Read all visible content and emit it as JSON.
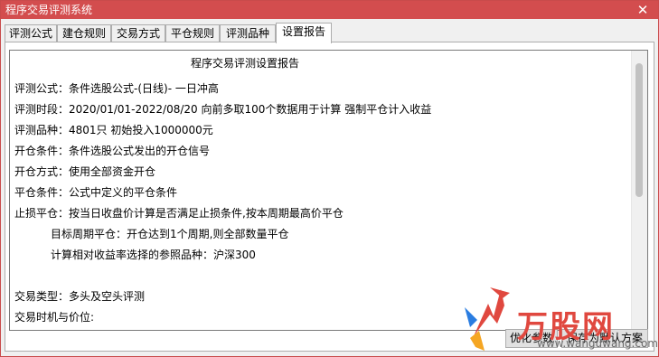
{
  "window": {
    "title": "程序交易评测系统",
    "close_glyph": "✕"
  },
  "tabs": [
    {
      "label": "评测公式",
      "active": false
    },
    {
      "label": "建仓规则",
      "active": false
    },
    {
      "label": "交易方式",
      "active": false
    },
    {
      "label": "平仓规则",
      "active": false
    },
    {
      "label": "评测品种",
      "active": false
    },
    {
      "label": "设置报告",
      "active": true
    }
  ],
  "report": {
    "title": "程序交易评测设置报告",
    "lines": [
      "评测公式：条件选股公式-(日线)- 一日冲高",
      "评测时段：2020/01/01-2022/08/20 向前多取100个数据用于计算 强制平仓计入收益",
      "评测品种：4801只 初始投入1000000元",
      "开仓条件：条件选股公式发出的开仓信号",
      "开仓方式：使用全部资金开仓",
      "平仓条件：公式中定义的平仓条件",
      "止损平仓：按当日收盘价计算是否满足止损条件,按本周期最高价平仓",
      "目标周期平仓：开仓达到1个周期,则全部数量平仓",
      "计算相对收益率选择的参照品种：沪深300",
      "",
      "交易类型：多头及空头评测",
      "交易时机与价位:"
    ]
  },
  "buttons": {
    "optimize": "优化参数",
    "save_default": "保存为默认方案"
  },
  "watermark": {
    "brand": "万股网",
    "url": "www.wanguwang.com"
  },
  "icons": {
    "close": "close-icon",
    "watermark_logo": "arrow-logo-icon"
  },
  "colors": {
    "titlebar": "#d34d4e",
    "brand_red": "#e0483f",
    "logo_orange": "#f5a623",
    "logo_blue": "#2a7de1"
  }
}
